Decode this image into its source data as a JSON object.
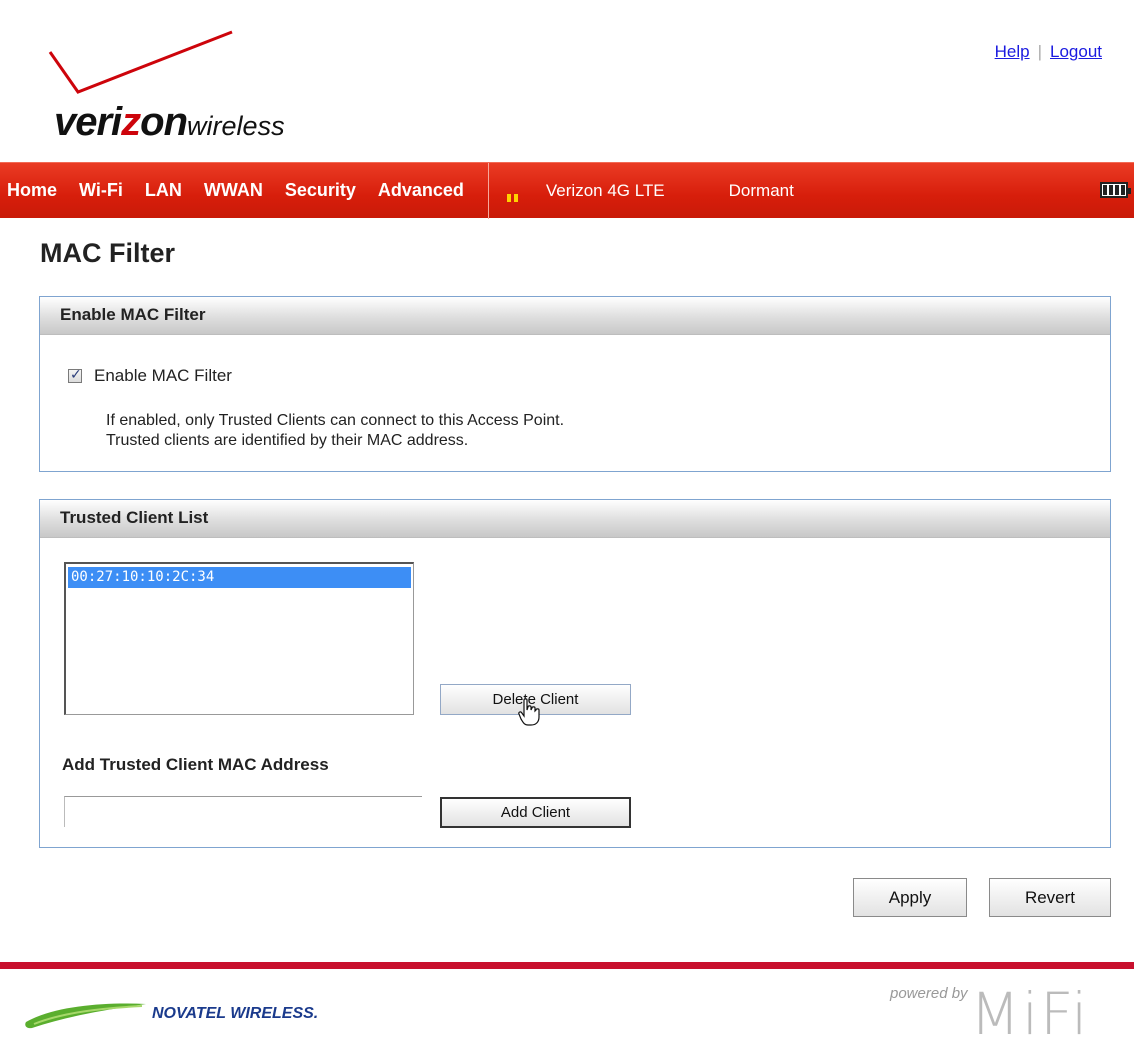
{
  "brand": {
    "logo_main_1": "veri",
    "logo_main_z": "z",
    "logo_main_2": "on",
    "logo_sub": "wireless"
  },
  "top_links": {
    "help": "Help",
    "separator": "|",
    "logout": "Logout"
  },
  "nav": {
    "items": [
      "Home",
      "Wi-Fi",
      "LAN",
      "WWAN",
      "Security",
      "Advanced"
    ],
    "network": "Verizon 4G LTE",
    "status": "Dormant",
    "signal_bars": 2
  },
  "page": {
    "title": "MAC Filter"
  },
  "enable_panel": {
    "header": "Enable MAC Filter",
    "checkbox_label": "Enable MAC Filter",
    "checked": true,
    "help_line1": "If enabled, only Trusted Clients can connect to this Access Point.",
    "help_line2": "Trusted clients are identified by their MAC address."
  },
  "trusted_panel": {
    "header": "Trusted Client List",
    "clients": [
      "00:27:10:10:2C:34"
    ],
    "delete_label": "Delete Client",
    "add_label": "Add Trusted Client MAC Address",
    "add_value": "",
    "add_button": "Add Client"
  },
  "actions": {
    "apply": "Apply",
    "revert": "Revert"
  },
  "footer": {
    "novatel": "NOVATEL WIRELESS.",
    "powered_by": "powered by",
    "mifi": "MiFi"
  },
  "colors": {
    "nav_red": "#d71e0b",
    "footer_red": "#c8102e",
    "selection_blue": "#3d8ef5",
    "panel_border": "#7fa4d0"
  }
}
